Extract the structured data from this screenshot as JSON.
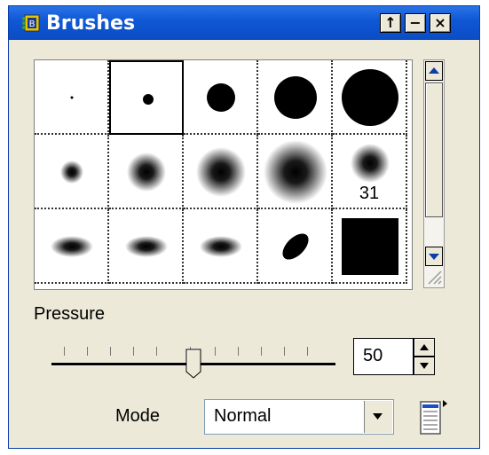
{
  "window": {
    "title": "Brushes",
    "buttons": {
      "pin": "↑",
      "minimize": "−",
      "close": "×"
    }
  },
  "brush_grid": {
    "brushes": [
      {
        "shape": "hard-dot",
        "size": 1,
        "selected": false,
        "label": ""
      },
      {
        "shape": "hard-dot",
        "size": 3,
        "selected": true,
        "label": ""
      },
      {
        "shape": "hard-dot",
        "size": 5,
        "selected": false,
        "label": ""
      },
      {
        "shape": "hard-dot",
        "size": 7,
        "selected": false,
        "label": ""
      },
      {
        "shape": "hard-dot",
        "size": 9,
        "selected": false,
        "label": ""
      },
      {
        "shape": "soft-dot",
        "size": 1,
        "selected": false,
        "label": ""
      },
      {
        "shape": "soft-dot",
        "size": 2,
        "selected": false,
        "label": ""
      },
      {
        "shape": "soft-dot",
        "size": 3,
        "selected": false,
        "label": ""
      },
      {
        "shape": "soft-dot",
        "size": 4,
        "selected": false,
        "label": ""
      },
      {
        "shape": "soft-dot",
        "size": 2,
        "selected": false,
        "label": "31"
      },
      {
        "shape": "soft-ellipse",
        "size": 2,
        "selected": false,
        "label": ""
      },
      {
        "shape": "soft-ellipse",
        "size": 2,
        "selected": false,
        "label": ""
      },
      {
        "shape": "soft-ellipse",
        "size": 2,
        "selected": false,
        "label": ""
      },
      {
        "shape": "angled-ellipse",
        "size": 2,
        "selected": false,
        "label": ""
      },
      {
        "shape": "square",
        "size": 9,
        "selected": false,
        "label": ""
      }
    ]
  },
  "pressure": {
    "label": "Pressure",
    "value": "50",
    "level": 0.5
  },
  "mode": {
    "label": "Mode",
    "selected": "Normal"
  },
  "icons": {
    "app": "brush-palette-icon",
    "scroll_up": "arrow-up-icon",
    "scroll_down": "arrow-down-icon",
    "resize": "resize-grip-icon",
    "dropdown": "chevron-down-icon",
    "menu": "palette-menu-icon"
  },
  "colors": {
    "title_bar": "#0a4cc4",
    "panel": "#ece9d8"
  }
}
